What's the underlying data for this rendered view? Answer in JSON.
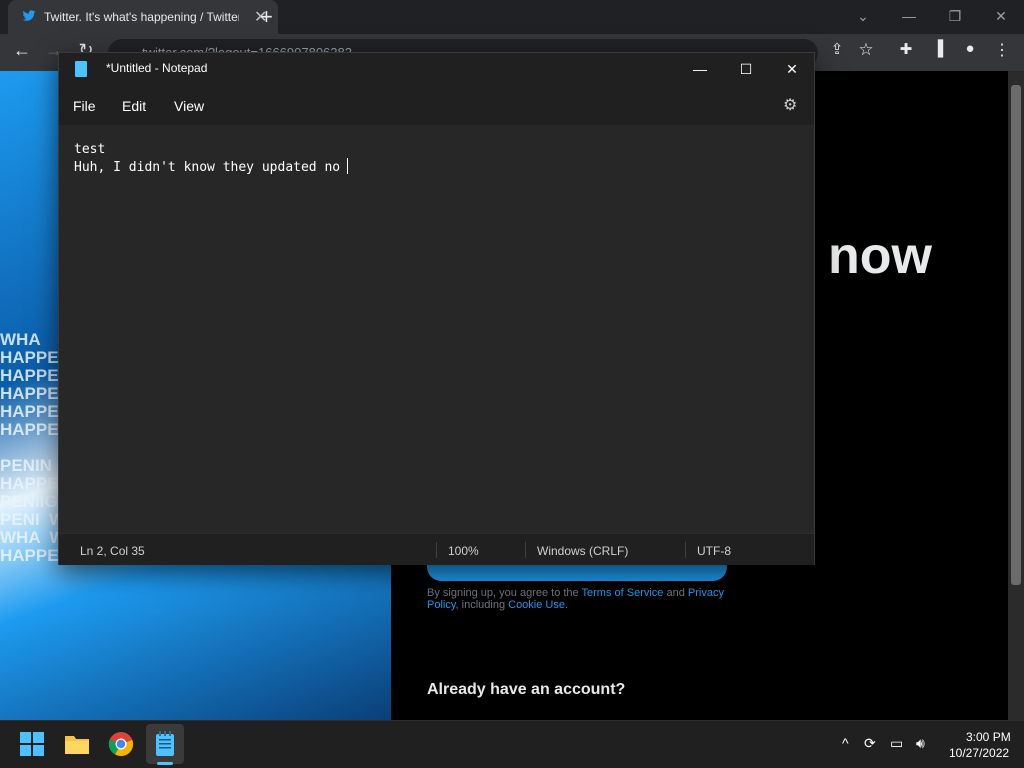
{
  "browser": {
    "tab_title": "Twitter. It's what's happening / Twitter",
    "address": "twitter.com/?logout=1666907806282",
    "colors": {
      "tab_icon": "#1d9bf0",
      "toolbar": "#35363a"
    }
  },
  "webpage": {
    "hero_text": "WHA\nHAPPENI\nHAPPENI\nHAPPENI\nHAPPENI\nHAPPENI\n\nPENIN\nHAPPENI\nPENIIG WHA  G HAPPENII  WHA\nPENI  WHA  G HAPPENII  WHA\nWHA  WHA  G HAPPENII  WHA\nHAPPENI  HAPPENI  HAPPENII",
    "headline": "now",
    "terms_prefix": "By signing up, you agree to the ",
    "terms_link": "Terms of Service",
    "terms_and": " and ",
    "privacy_link": "Privacy Policy",
    "terms_including": ", including ",
    "cookie_link": "Cookie Use",
    "terms_end": ".",
    "already_have_account": "Already have an account?"
  },
  "notepad": {
    "title": "*Untitled - Notepad",
    "menu": {
      "file": "File",
      "edit": "Edit",
      "view": "View"
    },
    "content": [
      "test",
      "Huh, I didn't know they updated no"
    ],
    "status": {
      "position": "Ln 2, Col 35",
      "zoom": "100%",
      "line_ending": "Windows (CRLF)",
      "encoding": "UTF-8"
    },
    "icons": {
      "settings": "gear-icon",
      "app": "notepad-icon"
    }
  },
  "taskbar": {
    "time": "3:00 PM",
    "date": "10/27/2022",
    "apps": [
      "start",
      "file-explorer",
      "chrome",
      "notepad"
    ],
    "colors": {
      "accent": "#4cc2ff"
    }
  }
}
